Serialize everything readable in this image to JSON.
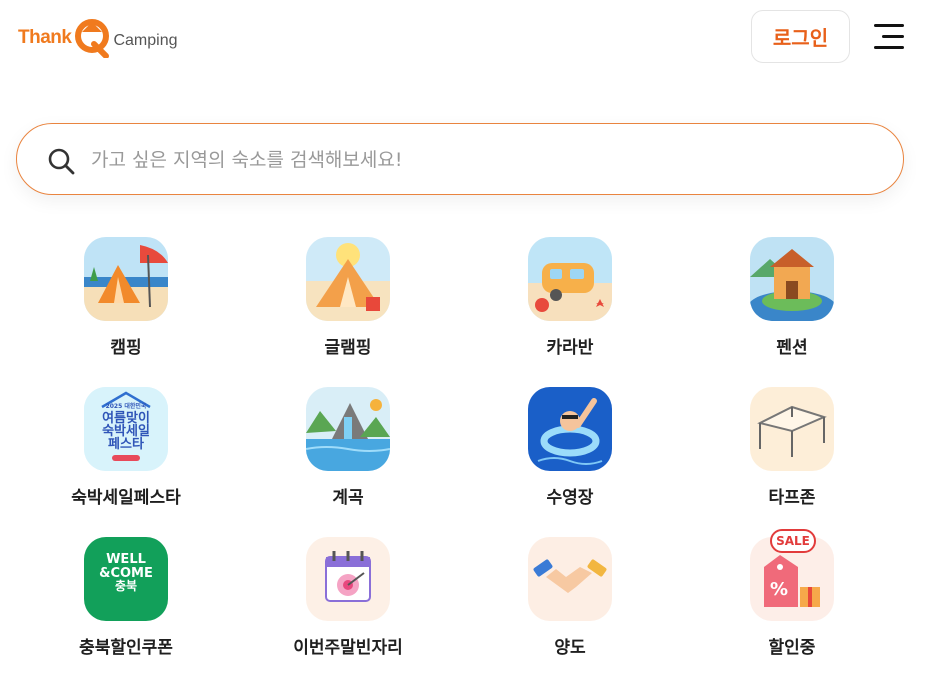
{
  "header": {
    "logo_left": "Thank",
    "logo_right": "Camping",
    "login_label": "로그인"
  },
  "search": {
    "placeholder": "가고 싶은 지역의 숙소를 검색해보세요!"
  },
  "categories": [
    {
      "label": "캠핑",
      "icon": "camping-tent-icon"
    },
    {
      "label": "글램핑",
      "icon": "glamping-tent-icon"
    },
    {
      "label": "카라반",
      "icon": "caravan-icon"
    },
    {
      "label": "펜션",
      "icon": "pension-house-icon"
    },
    {
      "label": "숙박세일페스타",
      "icon": "sale-festa-icon"
    },
    {
      "label": "계곡",
      "icon": "valley-waterfall-icon"
    },
    {
      "label": "수영장",
      "icon": "swimming-pool-icon"
    },
    {
      "label": "타프존",
      "icon": "tarp-zone-icon"
    },
    {
      "label": "충북할인쿠폰",
      "icon": "chungbuk-coupon-icon"
    },
    {
      "label": "이번주말빈자리",
      "icon": "weekend-calendar-icon"
    },
    {
      "label": "양도",
      "icon": "handshake-icon"
    },
    {
      "label": "할인중",
      "icon": "discount-tag-icon"
    }
  ],
  "festa_tile": {
    "year": "2025 대한민국",
    "line1": "여름맞이",
    "line2": "숙박세일",
    "line3": "페스타"
  },
  "wellcome_tile": {
    "line1": "WELL",
    "line2": "&COME",
    "line3": "충북"
  },
  "sale_badge": "SALE",
  "colors": {
    "brand_orange": "#f07a1e",
    "login_text": "#e8601a",
    "search_border": "#e9843f"
  }
}
